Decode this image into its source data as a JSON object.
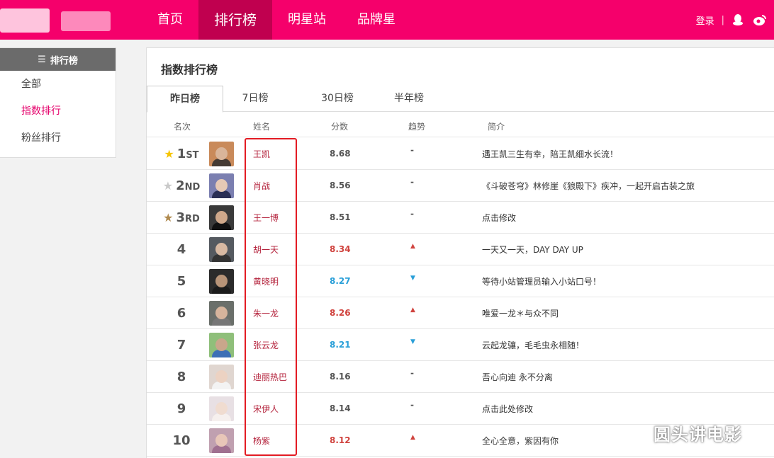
{
  "header": {
    "nav": [
      "首页",
      "排行榜",
      "明星站",
      "品牌星"
    ],
    "active_nav": 1,
    "login": "登录",
    "separator": "|",
    "icons": [
      "qq-icon",
      "weibo-icon"
    ]
  },
  "sidebar": {
    "title": "排行榜",
    "items": [
      "全部",
      "指数排行",
      "粉丝排行"
    ],
    "active_item": 1
  },
  "panel": {
    "title": "指数排行榜",
    "tabs": [
      "昨日榜",
      "7日榜",
      "30日榜",
      "半年榜"
    ],
    "active_tab": 0,
    "columns": [
      "名次",
      "姓名",
      "分数",
      "趋势",
      "简介"
    ]
  },
  "rows": [
    {
      "rank": "1",
      "suffix": "ST",
      "star": "gold",
      "name": "王凯",
      "score": "8.68",
      "trend": "flat",
      "trend_symbol": "-",
      "intro": "遇王凯三生有幸，陪王凯细水长流！"
    },
    {
      "rank": "2",
      "suffix": "ND",
      "star": "silver",
      "name": "肖战",
      "score": "8.56",
      "trend": "flat",
      "trend_symbol": "-",
      "intro": "《斗破苍穹》林修崖《狼殿下》疾冲，一起开启古装之旅"
    },
    {
      "rank": "3",
      "suffix": "RD",
      "star": "bronze",
      "name": "王一博",
      "score": "8.51",
      "trend": "flat",
      "trend_symbol": "-",
      "intro": "点击修改"
    },
    {
      "rank": "4",
      "suffix": "",
      "star": "",
      "name": "胡一天",
      "score": "8.34",
      "trend": "up",
      "trend_symbol": "▲",
      "intro": "一天又一天，DAY DAY UP"
    },
    {
      "rank": "5",
      "suffix": "",
      "star": "",
      "name": "黄晓明",
      "score": "8.27",
      "trend": "down",
      "trend_symbol": "▼",
      "intro": "等待小站管理员输入小站口号！"
    },
    {
      "rank": "6",
      "suffix": "",
      "star": "",
      "name": "朱一龙",
      "score": "8.26",
      "trend": "up",
      "trend_symbol": "▲",
      "intro": "唯爱一龙＊与众不同"
    },
    {
      "rank": "7",
      "suffix": "",
      "star": "",
      "name": "张云龙",
      "score": "8.21",
      "trend": "down",
      "trend_symbol": "▼",
      "intro": "云起龙骧，毛毛虫永相随！"
    },
    {
      "rank": "8",
      "suffix": "",
      "star": "",
      "name": "迪丽热巴",
      "score": "8.16",
      "trend": "flat",
      "trend_symbol": "-",
      "intro": "吾心向迪 永不分离"
    },
    {
      "rank": "9",
      "suffix": "",
      "star": "",
      "name": "宋伊人",
      "score": "8.14",
      "trend": "flat",
      "trend_symbol": "-",
      "intro": "点击此处修改"
    },
    {
      "rank": "10",
      "suffix": "",
      "star": "",
      "name": "杨紫",
      "score": "8.12",
      "trend": "up",
      "trend_symbol": "▲",
      "intro": "全心全意，紫因有你"
    }
  ],
  "watermark": "圆头讲电影",
  "colors": {
    "brand": "#f5006b",
    "nav_active": "#c0004f",
    "name": "#b4233c",
    "up": "#d0443f",
    "down": "#2a9fd8",
    "highlight_box": "#e31b23"
  }
}
